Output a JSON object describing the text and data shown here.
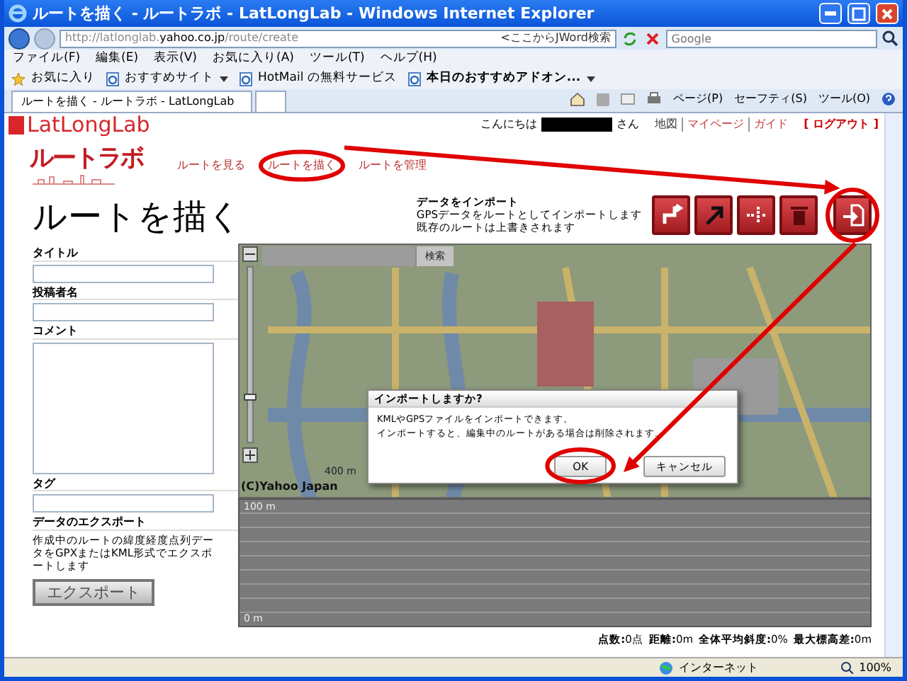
{
  "window": {
    "title": "ルートを描く - ルートラボ - LatLongLab - Windows Internet Explorer"
  },
  "address_bar": {
    "url_parts": [
      {
        "text": "http://latlonglab.",
        "emphasized": false
      },
      {
        "text": "yahoo.co.jp",
        "emphasized": true
      },
      {
        "text": "/route/create",
        "emphasized": false
      }
    ],
    "jword": "<ここからJWord検索",
    "search_placeholder": "Google"
  },
  "menu": [
    "ファイル(F)",
    "編集(E)",
    "表示(V)",
    "お気に入り(A)",
    "ツール(T)",
    "ヘルプ(H)"
  ],
  "favorites_bar": {
    "favorites": "お気に入り",
    "links": [
      {
        "label": "おすすめサイト",
        "dropdown": true,
        "bold": false
      },
      {
        "label": "HotMail の無料サービス",
        "dropdown": false,
        "bold": false
      },
      {
        "label": "本日のおすすめアドオン...",
        "dropdown": true,
        "bold": true
      }
    ]
  },
  "tab": {
    "label": "ルートを描く - ルートラボ - LatLongLab"
  },
  "command_bar": [
    "ページ(P)",
    "セーフティ(S)",
    "ツール(O)"
  ],
  "page": {
    "header": {
      "logo": "LatLongLab",
      "greeting": "こんにちは",
      "suffix": "さん",
      "links": [
        "地図",
        "マイページ",
        "ガイド"
      ],
      "logout": "[ ログアウト ]"
    },
    "site_logo": "ルートラボ",
    "nav": [
      "ルートを見る",
      "ルートを描く",
      "ルートを管理"
    ],
    "heading": "ルートを描く",
    "import_info": {
      "title": "データをインポート",
      "lines": [
        "GPSデータをルートとしてインポートします",
        "既存のルートは上書きされます"
      ]
    },
    "tools": [
      {
        "kind": "route"
      },
      {
        "kind": "arrow"
      },
      {
        "kind": "split"
      },
      {
        "kind": "trash"
      },
      {
        "kind": "import"
      }
    ],
    "form": [
      {
        "label": "タイトル",
        "kind": "input"
      },
      {
        "label": "投稿者名",
        "kind": "input"
      },
      {
        "label": "コメント",
        "kind": "textarea"
      },
      {
        "label": "タグ",
        "kind": "input"
      }
    ],
    "export": {
      "title": "データのエクスポート",
      "description": "作成中のルートの緯度経度点列データをGPXまたはKML形式でエクスポートします",
      "button": "エクスポート"
    },
    "map": {
      "search_button": "検索",
      "zoom_slider": {
        "level": 0.25
      },
      "scale": "400 m",
      "copyright": "(C)Yahoo Japan"
    },
    "dialog": {
      "title": "インポートしますか?",
      "lines": [
        "KMLやGPSファイルをインポートできます。",
        "インポートすると、編集中のルートがある場合は削除されます。"
      ],
      "buttons": [
        "OK",
        "キャンセル"
      ]
    },
    "elevation": {
      "top_label": "100 m",
      "bottom_label": "0 m"
    },
    "stats": [
      {
        "label": "点数:",
        "value": "0点"
      },
      {
        "label": "距離:",
        "value": "0m"
      },
      {
        "label": "全体平均斜度:",
        "value": "0%"
      },
      {
        "label": "最大標高差:",
        "value": "0m"
      }
    ]
  },
  "status_bar": {
    "zone": "インターネット",
    "zoom": "100%"
  },
  "annotations": [
    {
      "kind": "arrow"
    },
    {
      "kind": "circle"
    },
    {
      "kind": "circle"
    },
    {
      "kind": "arrow"
    },
    {
      "kind": "circle"
    }
  ]
}
